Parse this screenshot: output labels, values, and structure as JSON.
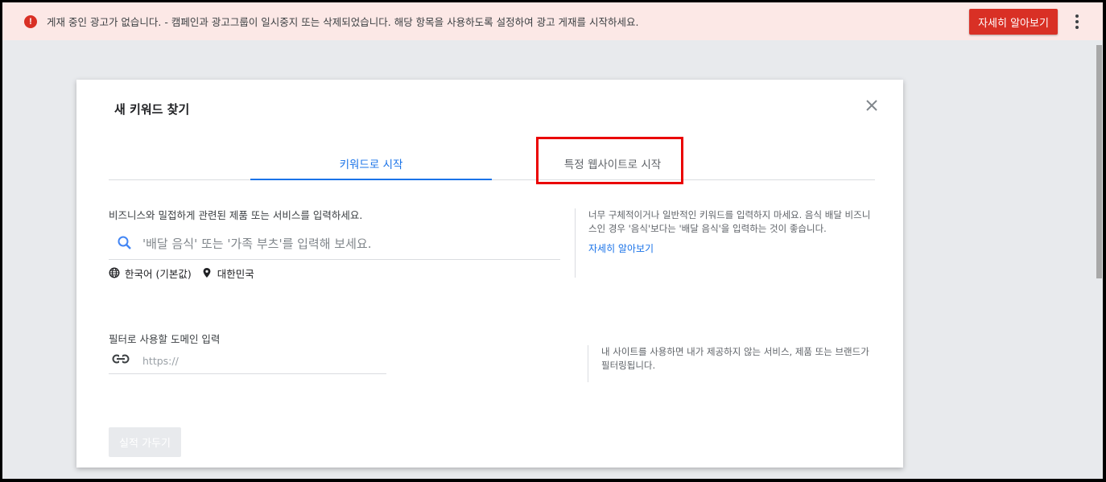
{
  "banner": {
    "message": "게재 중인 광고가 없습니다. - 캠페인과 광고그룹이 일시중지 또는 삭제되었습니다. 해당 항목을 사용하도록 설정하여 광고 게재를 시작하세요.",
    "learn_more": "자세히 알아보기",
    "icon": "error-icon",
    "color": "#d93025"
  },
  "dialog": {
    "title": "새 키워드 찾기",
    "tabs": [
      {
        "label": "키워드로 시작",
        "active": true
      },
      {
        "label": "특정 웹사이트로 시작",
        "active": false
      }
    ],
    "keyword_prompt": "비즈니스와 밀접하게 관련된 제품 또는 서비스를 입력하세요.",
    "search_placeholder": "'배달 음식' 또는 '가족 부츠'를 입력해 보세요.",
    "language": "한국어 (기본값)",
    "location": "대한민국",
    "keyword_tip": "너무 구체적이거나 일반적인 키워드를 입력하지 마세요. 음식 배달 비즈니스인 경우 '음식'보다는 '배달 음식'을 입력하는 것이 좋습니다.",
    "tip_link": "자세히 알아보기",
    "domain_label": "필터로 사용할 도메인 입력",
    "domain_placeholder": "https://",
    "domain_tip": "내 사이트를 사용하면 내가 제공하지 않는 서비스, 제품 또는 브랜드가 필터링됩니다.",
    "results_button": "실적 가두기"
  },
  "colors": {
    "accent": "#1a73e8",
    "highlight": "#ea0000"
  }
}
